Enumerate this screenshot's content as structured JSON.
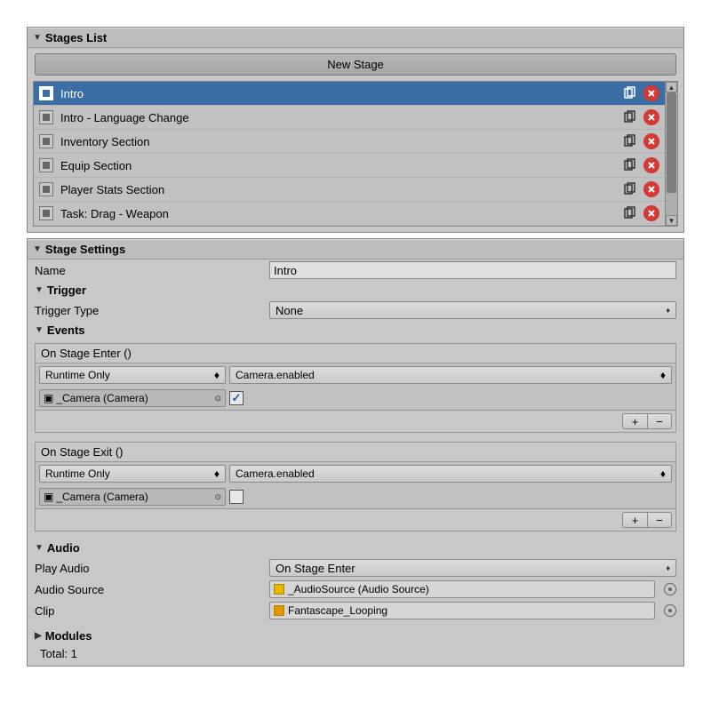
{
  "stagesList": {
    "title": "Stages List",
    "newStageLabel": "New Stage",
    "items": [
      {
        "label": "Intro",
        "selected": true
      },
      {
        "label": "Intro - Language Change",
        "selected": false
      },
      {
        "label": "Inventory Section",
        "selected": false
      },
      {
        "label": "Equip Section",
        "selected": false
      },
      {
        "label": "Player Stats Section",
        "selected": false
      },
      {
        "label": "Task: Drag - Weapon",
        "selected": false
      }
    ]
  },
  "stageSettings": {
    "title": "Stage Settings",
    "nameLabel": "Name",
    "nameValue": "Intro",
    "trigger": {
      "title": "Trigger",
      "typeLabel": "Trigger Type",
      "typeValue": "None"
    },
    "events": {
      "title": "Events",
      "enter": {
        "header": "On Stage Enter ()",
        "runtime": "Runtime Only",
        "method": "Camera.enabled",
        "target": "_Camera (Camera)",
        "boolValue": true
      },
      "exit": {
        "header": "On Stage Exit ()",
        "runtime": "Runtime Only",
        "method": "Camera.enabled",
        "target": "_Camera (Camera)",
        "boolValue": false
      },
      "plus": "+",
      "minus": "−"
    },
    "audio": {
      "title": "Audio",
      "playLabel": "Play Audio",
      "playValue": "On Stage Enter",
      "sourceLabel": "Audio Source",
      "sourceValue": "_AudioSource (Audio Source)",
      "clipLabel": "Clip",
      "clipValue": "Fantascape_Looping"
    },
    "modules": {
      "title": "Modules",
      "totalLabel": "Total: 1"
    }
  }
}
